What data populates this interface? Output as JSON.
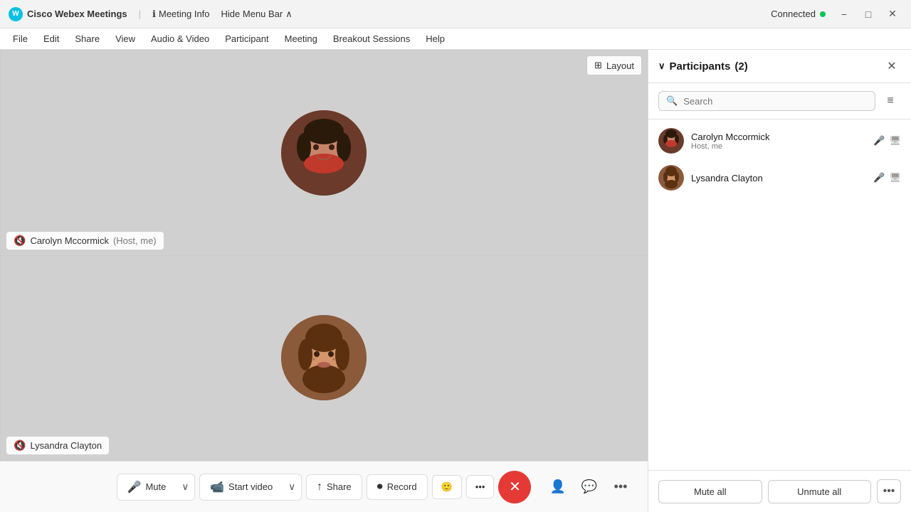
{
  "app": {
    "logo_text": "W",
    "title": "Cisco Webex Meetings",
    "separator": "|"
  },
  "title_bar": {
    "meeting_info": "Meeting Info",
    "hide_menu": "Hide Menu Bar",
    "connected": "Connected"
  },
  "menu": {
    "items": [
      "File",
      "Edit",
      "Share",
      "View",
      "Audio & Video",
      "Participant",
      "Meeting",
      "Breakout Sessions",
      "Help"
    ]
  },
  "video": {
    "layout_btn": "Layout",
    "participant1": {
      "name": "Carolyn Mccormick",
      "label": "Carolyn Mccormick",
      "role": "(Host, me)"
    },
    "participant2": {
      "name": "Lysandra Clayton",
      "label": "Lysandra Clayton"
    }
  },
  "toolbar": {
    "mute_label": "Mute",
    "start_video_label": "Start video",
    "share_label": "Share",
    "record_label": "Record",
    "more_label": "•••",
    "more2_label": "•••",
    "chevron_down": "∨"
  },
  "participants_panel": {
    "title": "Participants",
    "count": "(2)",
    "search_placeholder": "Search",
    "close_icon": "✕",
    "participants": [
      {
        "name": "Carolyn Mccormick",
        "role": "Host, me",
        "muted": false
      },
      {
        "name": "Lysandra Clayton",
        "role": "",
        "muted": false
      }
    ],
    "mute_all_label": "Mute all",
    "unmute_all_label": "Unmute all"
  }
}
